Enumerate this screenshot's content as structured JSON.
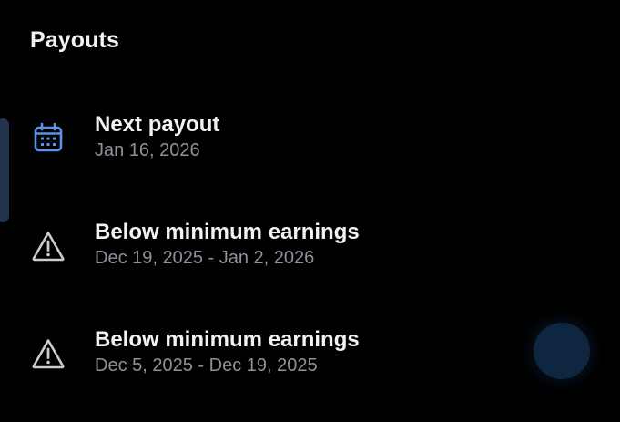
{
  "header": {
    "title": "Payouts"
  },
  "payouts": {
    "items": [
      {
        "icon": "calendar-icon",
        "title": "Next payout",
        "subtitle": "Jan 16, 2026"
      },
      {
        "icon": "warning-icon",
        "title": "Below minimum earnings",
        "subtitle": "Dec 19, 2025 - Jan 2, 2026"
      },
      {
        "icon": "warning-icon",
        "title": "Below minimum earnings",
        "subtitle": "Dec 5, 2025 - Dec 19, 2025"
      }
    ]
  },
  "colors": {
    "background": "#000000",
    "title_text": "#f2f2f2",
    "subtitle_text": "#8d939a",
    "calendar_accent": "#5a94e8",
    "warning_icon": "#c9ccd1",
    "fab": "#0f2640"
  }
}
